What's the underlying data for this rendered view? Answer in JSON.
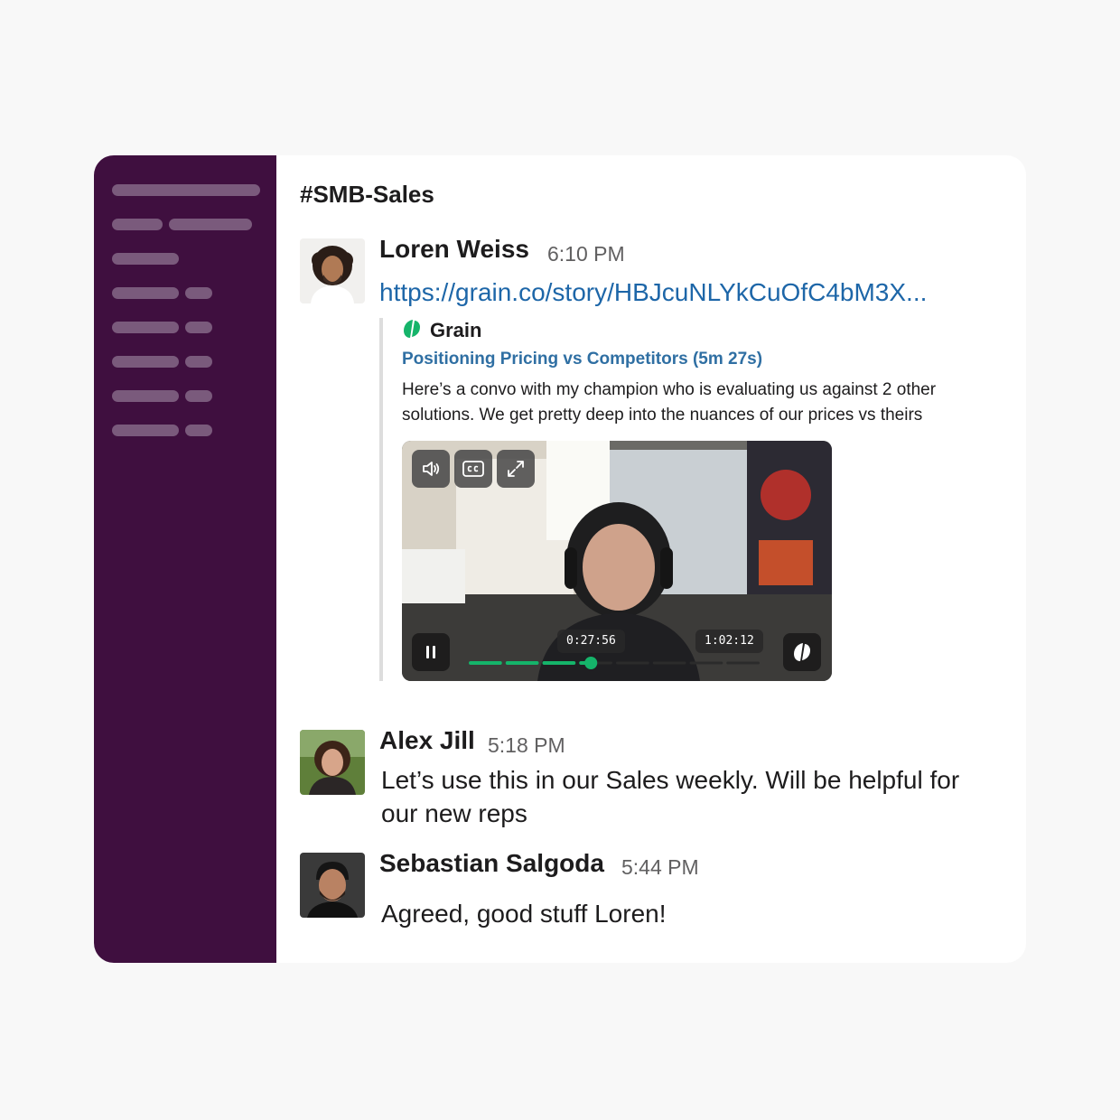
{
  "channel": {
    "name": "#SMB-Sales"
  },
  "messages": [
    {
      "author": "Loren Weiss",
      "time": "6:10 PM",
      "link": "https://grain.co/story/HBJcuNLYkCuOfC4bM3X...",
      "attachment": {
        "provider": "Grain",
        "title": "Positioning Pricing vs Competitors (5m 27s)",
        "description": "Here’s a convo with my champion who is evaluating us against 2 other solutions. We get pretty deep into the nuances of our prices vs theirs",
        "video": {
          "current_time": "0:27:56",
          "total_time": "1:02:12",
          "progress_fraction": 0.42,
          "accent_color": "#15b46a",
          "controls": [
            "volume-icon",
            "closed-captions-icon",
            "fullscreen-icon",
            "pause-icon",
            "grain-logo-icon"
          ]
        }
      }
    },
    {
      "author": "Alex Jill",
      "time": "5:18 PM",
      "text": "Let’s use this in our Sales weekly. Will be helpful for our new reps"
    },
    {
      "author": "Sebastian Salgoda",
      "time": "5:44 PM",
      "text": "Agreed, good stuff Loren!"
    }
  ],
  "colors": {
    "sidebar": "#3f0f3f",
    "link": "#1d66a8",
    "grain_green": "#15b46a"
  }
}
